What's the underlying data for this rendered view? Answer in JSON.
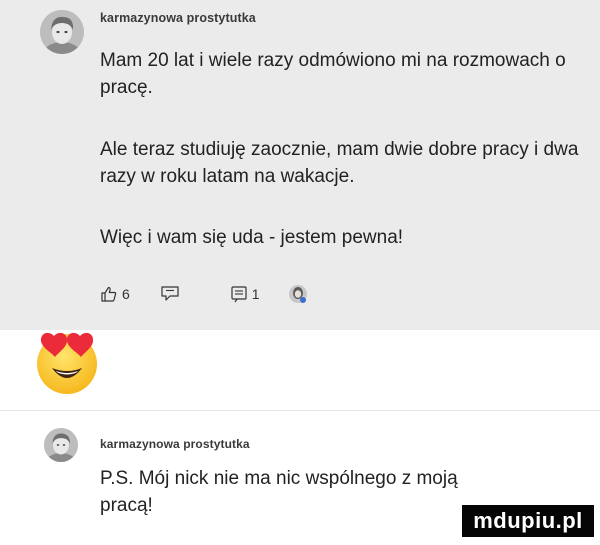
{
  "comment1": {
    "author": "karmazynowa prostytutka",
    "paragraphs": [
      "Mam 20 lat i wiele razy odmówiono mi na rozmowach o pracę.",
      "Ale teraz studiuję zaocznie, mam dwie dobre pracy i dwa razy w roku latam na wakacje.",
      "Więc i wam się uda - jestem pewna!"
    ],
    "actions": {
      "likes_count": "6",
      "replies_count": "1"
    }
  },
  "reaction_emoji": {
    "icon": "heart-eyes-emoji"
  },
  "comment2": {
    "author": "karmazynowa prostytutka",
    "text": "P.S. Mój nick nie ma nic wspólnego z moją pracą!"
  },
  "watermark": {
    "text": "mdupiu.pl"
  }
}
